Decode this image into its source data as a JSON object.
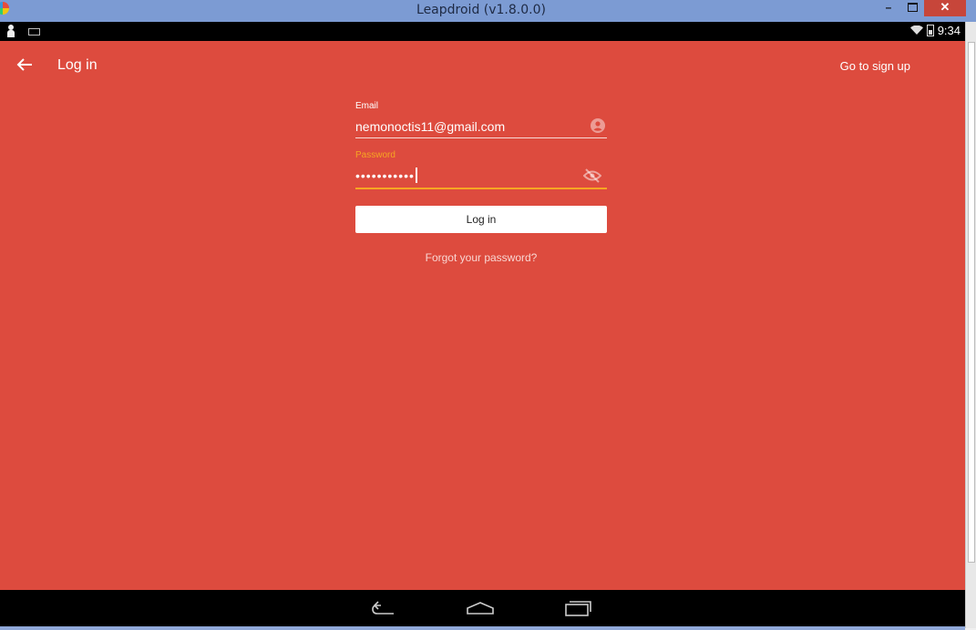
{
  "window": {
    "title": "Leapdroid (v1.8.0.0)",
    "minimize_label": "–",
    "close_label": "✕"
  },
  "status_bar": {
    "time": "9:34"
  },
  "toolbar": {
    "title": "Log in",
    "signup_link": "Go to sign up"
  },
  "form": {
    "email_label": "Email",
    "email_value": "nemonoctis11@gmail.com",
    "password_label": "Password",
    "password_masked": "•••••••••••",
    "login_button": "Log in",
    "forgot_link": "Forgot your password?"
  },
  "colors": {
    "app_background": "#dd4b3e",
    "accent": "#f6a623",
    "titlebar": "#7c9bd3",
    "close_button": "#c7463a"
  },
  "icons": {
    "back": "arrow-back-icon",
    "email_field": "account-circle-icon",
    "password_field": "visibility-off-icon",
    "nav": [
      "nav-back-icon",
      "nav-home-icon",
      "nav-recents-icon"
    ]
  }
}
